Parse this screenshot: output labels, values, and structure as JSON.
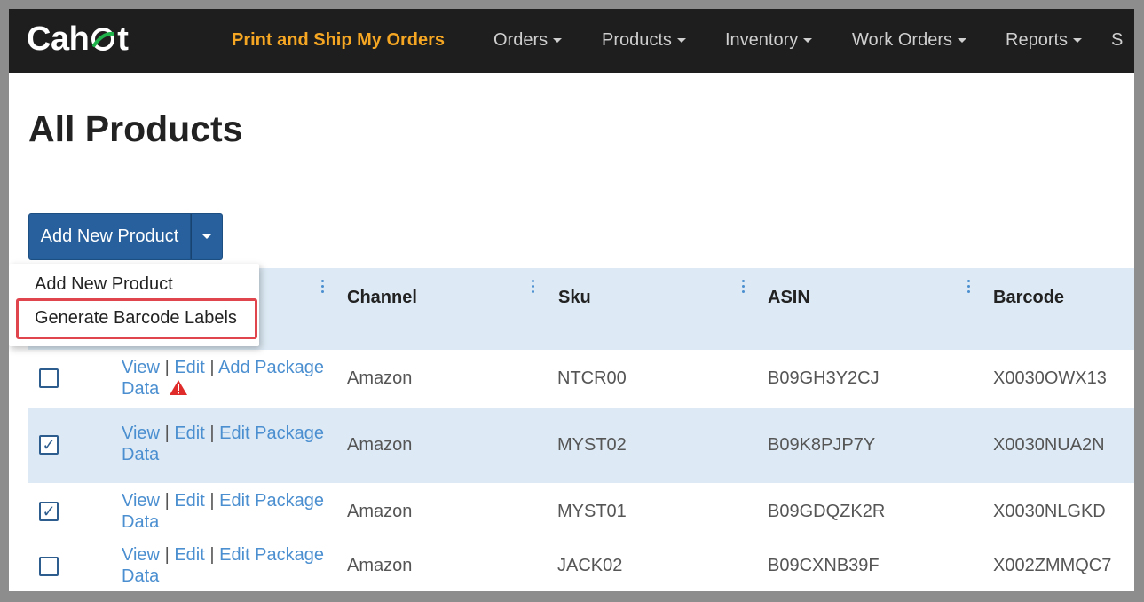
{
  "app": {
    "logo_text_1": "Cah",
    "logo_text_2": "t",
    "colors": {
      "nav_bg": "#1e1e1e",
      "nav_highlight": "#f5a623",
      "primary": "#27609c",
      "link": "#4b8fd0",
      "header_bg": "#ddeaf5",
      "highlight_border": "#e0454e"
    }
  },
  "nav": {
    "highlight": "Print and Ship My Orders",
    "items": [
      "Orders",
      "Products",
      "Inventory",
      "Work Orders",
      "Reports",
      "S"
    ]
  },
  "page": {
    "title": "All Products"
  },
  "add_button": {
    "label": "Add New Product",
    "toggle_icon": "caret-down-icon"
  },
  "dropdown": {
    "items": [
      "Add New Product",
      "Generate Barcode Labels"
    ]
  },
  "table": {
    "columns": [
      "Channel",
      "Sku",
      "ASIN",
      "Barcode"
    ],
    "rows": [
      {
        "checked": false,
        "view": "View",
        "edit": "Edit",
        "package_1": "Add Package",
        "package_2": "Data",
        "warning": true,
        "channel": "Amazon",
        "sku": "NTCR00",
        "asin": "B09GH3Y2CJ",
        "barcode": "X0030OWX13"
      },
      {
        "checked": true,
        "view": "View",
        "edit": "Edit",
        "package_1": "Edit Package",
        "package_2": "Data",
        "warning": false,
        "channel": "Amazon",
        "sku": "MYST02",
        "asin": "B09K8PJP7Y",
        "barcode": "X0030NUA2N"
      },
      {
        "checked": true,
        "view": "View",
        "edit": "Edit",
        "package_1": "Edit Package",
        "package_2": "Data",
        "warning": false,
        "channel": "Amazon",
        "sku": "MYST01",
        "asin": "B09GDQZK2R",
        "barcode": "X0030NLGKD"
      },
      {
        "checked": false,
        "view": "View",
        "edit": "Edit",
        "package_1": "Edit Package",
        "package_2": "Data",
        "warning": false,
        "channel": "Amazon",
        "sku": "JACK02",
        "asin": "B09CXNB39F",
        "barcode": "X002ZMMQC7"
      }
    ],
    "separator": "|",
    "check_mark": "✓"
  }
}
